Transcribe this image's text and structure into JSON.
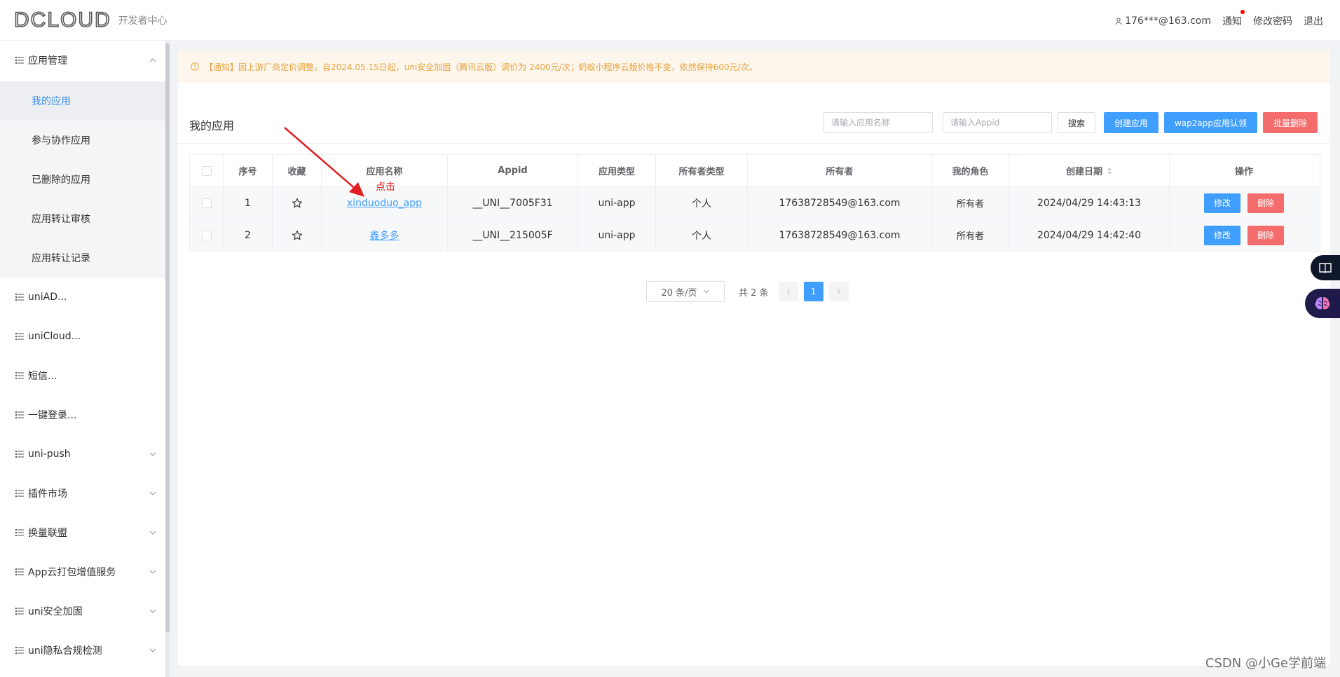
{
  "header": {
    "logo": "DCLOUD",
    "subtitle": "开发者中心",
    "user": "176***@163.com",
    "notice": "通知",
    "change_password": "修改密码",
    "logout": "退出"
  },
  "sidebar": {
    "items": [
      {
        "label": "应用管理"
      },
      {
        "label": "uniAD..."
      },
      {
        "label": "uniCloud..."
      },
      {
        "label": "短信..."
      },
      {
        "label": "一键登录..."
      },
      {
        "label": "uni-push"
      },
      {
        "label": "插件市场"
      },
      {
        "label": "换量联盟"
      },
      {
        "label": "App云打包增值服务"
      },
      {
        "label": "uni安全加固"
      },
      {
        "label": "uni隐私合规检测"
      }
    ],
    "sub_items": [
      {
        "label": "我的应用"
      },
      {
        "label": "参与协作应用"
      },
      {
        "label": "已删除的应用"
      },
      {
        "label": "应用转让审核"
      },
      {
        "label": "应用转让记录"
      }
    ]
  },
  "notice_bar": {
    "text": "【通知】因上游厂商定价调整，自2024.05.15日起，uni安全加固（腾讯云版）调价为 2400元/次；蚂蚁小程序云版价格不变，依然保持600元/次。"
  },
  "main": {
    "title": "我的应用",
    "search_name_placeholder": "请输入应用名称",
    "search_appid_placeholder": "请输入Appid",
    "search_button": "搜索",
    "create_button": "创建应用",
    "wap2app_button": "wap2app应用认领",
    "batch_delete_button": "批量删除"
  },
  "table": {
    "columns": [
      "序号",
      "收藏",
      "应用名称",
      "Appid",
      "应用类型",
      "所有者类型",
      "所有者",
      "我的角色",
      "创建日期",
      "操作"
    ],
    "rows": [
      {
        "index": "1",
        "name": "xinduoduo_app",
        "appid": "__UNI__7005F31",
        "type": "uni-app",
        "owner_type": "个人",
        "owner": "17638728549@163.com",
        "role": "所有者",
        "created": "2024/04/29 14:43:13"
      },
      {
        "index": "2",
        "name": "鑫多多",
        "appid": "__UNI__215005F",
        "type": "uni-app",
        "owner_type": "个人",
        "owner": "17638728549@163.com",
        "role": "所有者",
        "created": "2024/04/29 14:42:40"
      }
    ],
    "edit_label": "修改",
    "delete_label": "删除"
  },
  "pagination": {
    "page_size": "20 条/页",
    "total": "共 2 条",
    "current_page": "1"
  },
  "annotation": {
    "text": "点击"
  },
  "watermark": "CSDN @小Ge学前端",
  "colors": {
    "primary": "#409eff",
    "danger": "#f56c6c",
    "notice_bg": "#fdf6ec",
    "notice_text": "#e6a23c"
  }
}
